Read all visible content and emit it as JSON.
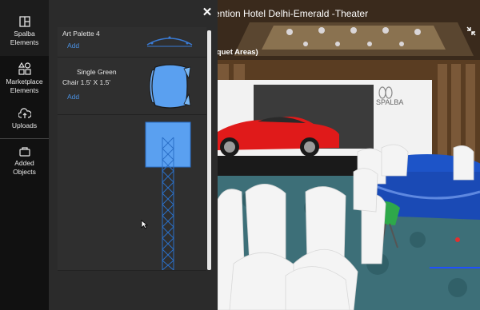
{
  "nav": {
    "items": [
      {
        "label_line1": "Spalba",
        "label_line2": "Elements",
        "icon": "grid-icon"
      },
      {
        "label_line1": "Marketplace",
        "label_line2": "Elements",
        "icon": "shapes-icon"
      },
      {
        "label_line1": "Uploads",
        "label_line2": "",
        "icon": "cloud-upload-icon"
      },
      {
        "label_line1": "Added",
        "label_line2": "Objects",
        "icon": "box-icon"
      }
    ]
  },
  "panel": {
    "close_icon": "close-icon",
    "items": [
      {
        "title": "Art Palette 4",
        "add_label": "Add"
      },
      {
        "title_line1": "Single Green",
        "title_line2": "Chair 1.5' X 1.5'",
        "add_label": "Add"
      },
      {
        "title": "",
        "add_label": ""
      }
    ]
  },
  "scene": {
    "title": "vention Hotel Delhi-Emerald -Theater",
    "subtitle": "nquet Areas)",
    "brand_text": "SPALBA",
    "expand_icon": "collapse-icon"
  }
}
